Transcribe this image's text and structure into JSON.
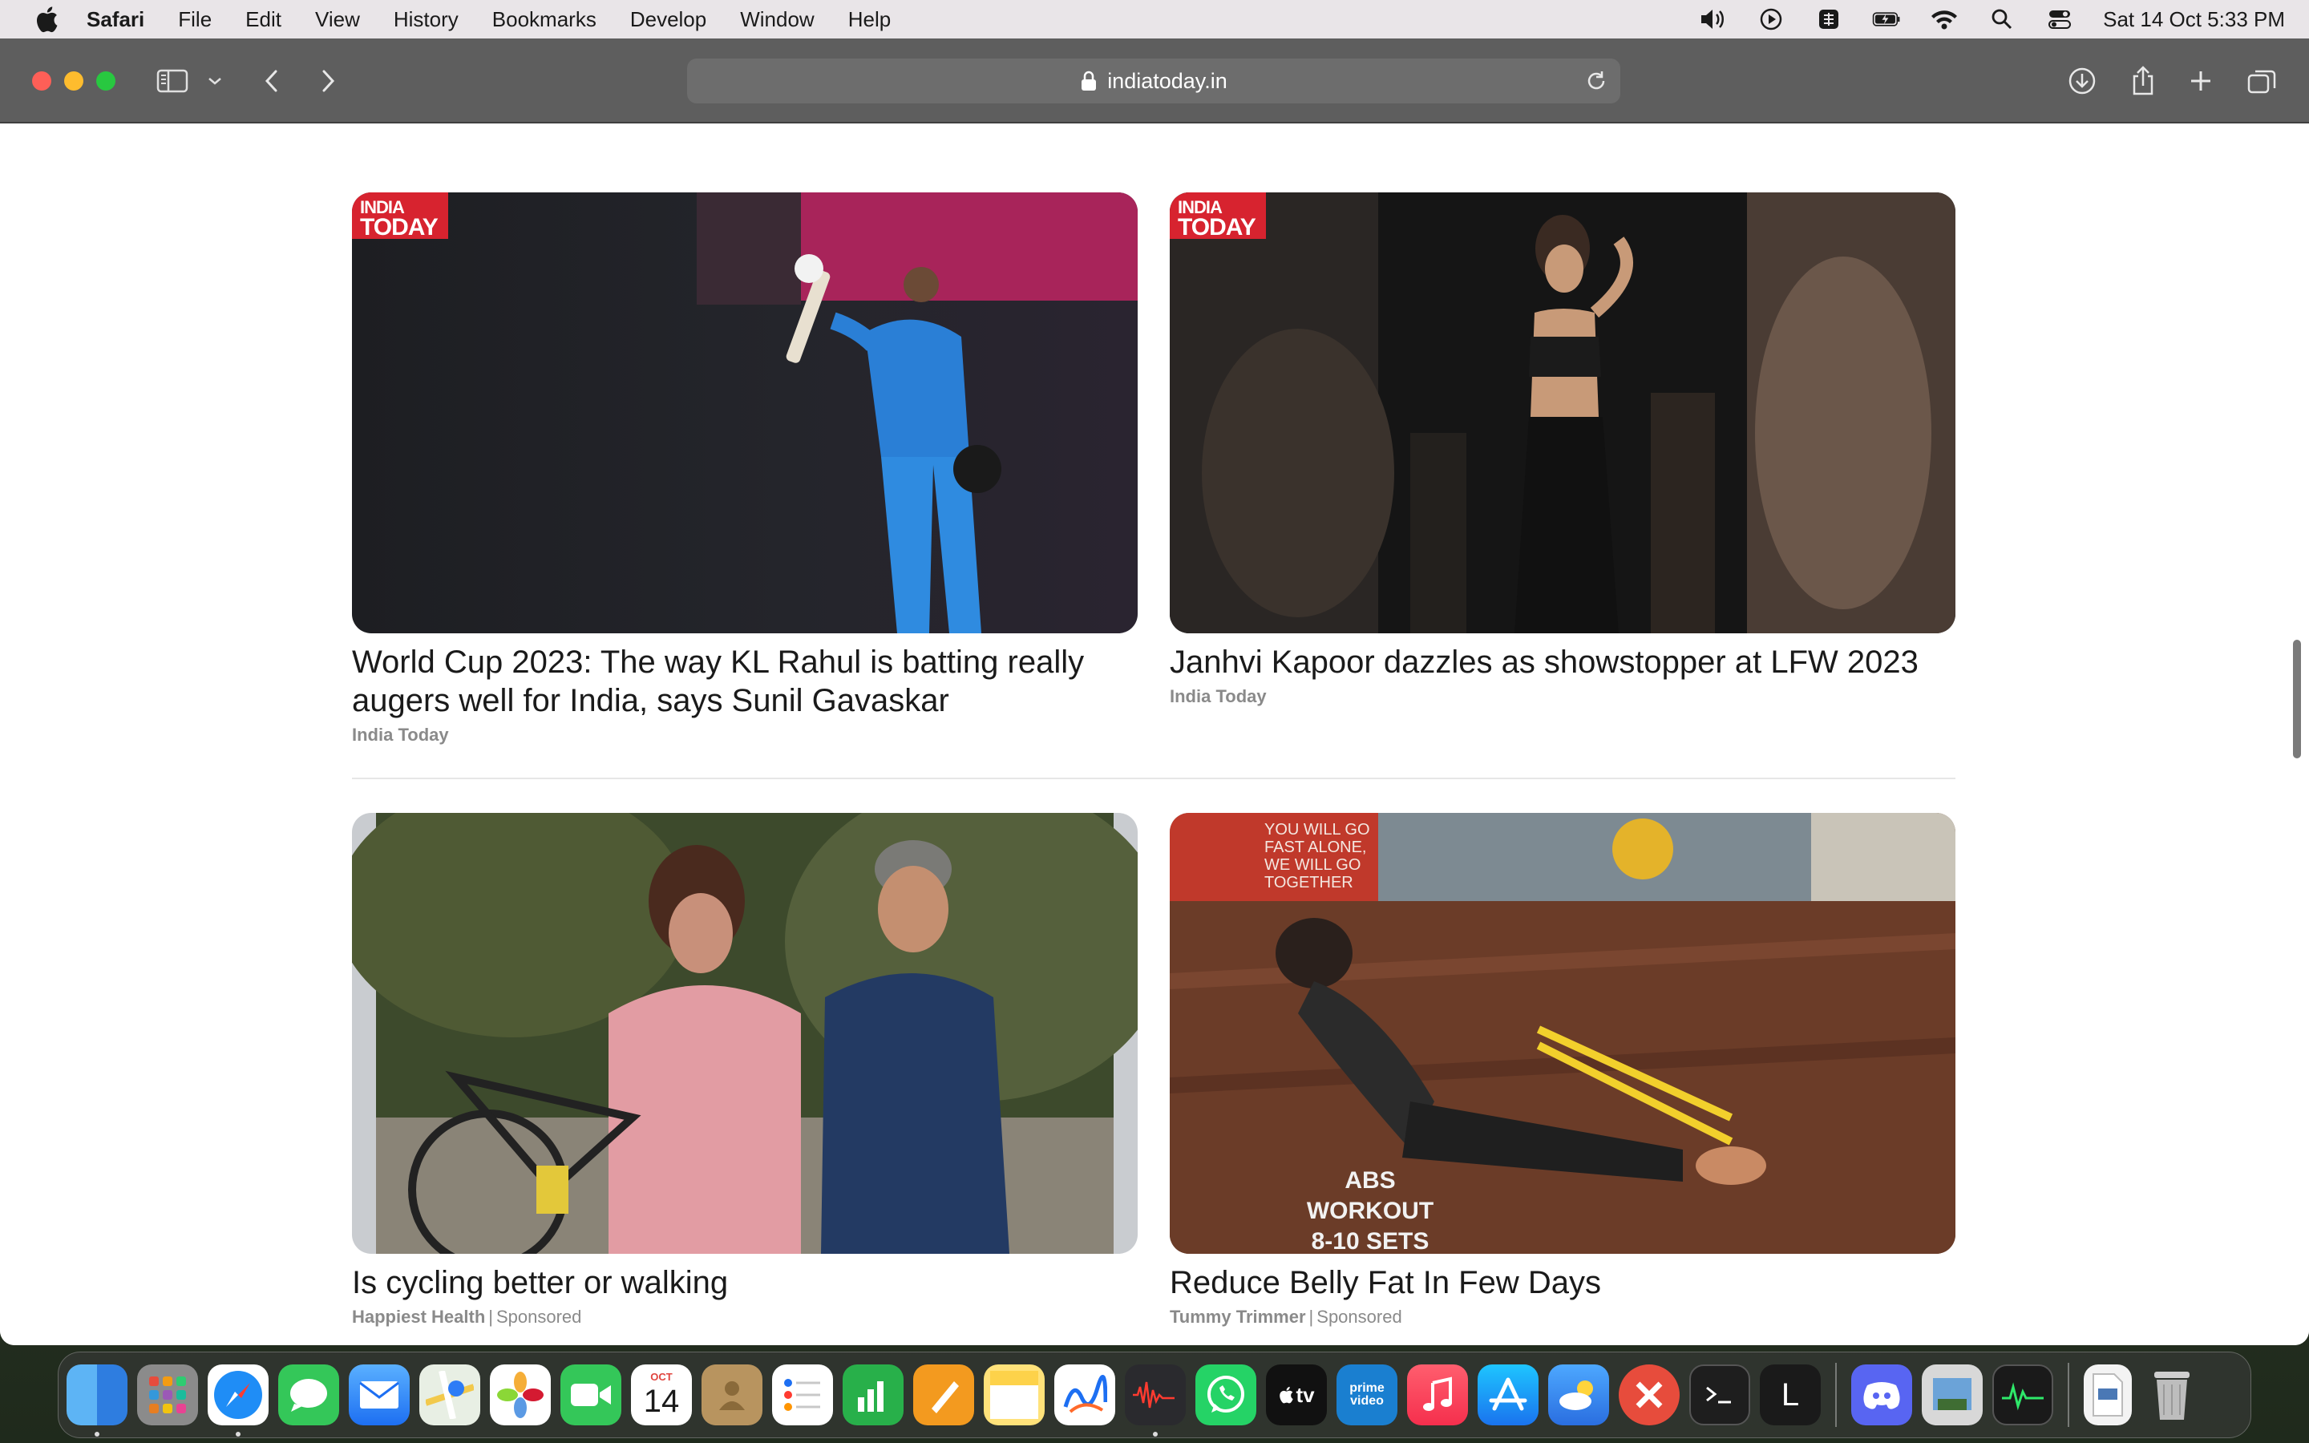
{
  "menubar": {
    "app_name": "Safari",
    "items": [
      "File",
      "Edit",
      "View",
      "History",
      "Bookmarks",
      "Develop",
      "Window",
      "Help"
    ],
    "clock": "Sat 14 Oct  5:33 PM"
  },
  "browser": {
    "url": "indiatoday.in"
  },
  "cards": [
    {
      "title": "World Cup 2023: The way KL Rahul is batting really augers well for India, says Sunil Gavaskar",
      "source": "India Today",
      "badge_line1": "INDIA",
      "badge_line2": "TODAY"
    },
    {
      "title": "Janhvi Kapoor dazzles as showstopper at LFW 2023",
      "source": "India Today",
      "badge_line1": "INDIA",
      "badge_line2": "TODAY"
    },
    {
      "title": "Is cycling better or walking",
      "source": "Happiest Health",
      "sponsored": "Sponsored"
    },
    {
      "title": "Reduce Belly Fat In Few Days",
      "source": "Tummy Trimmer",
      "sponsored": "Sponsored",
      "overlay_line1": "ABS WORKOUT",
      "overlay_line2": "8-10 SETS",
      "wall_text": "YOU WILL GO FAST ALONE, WE WILL GO TOGETHER"
    }
  ],
  "dock": {
    "calendar_month": "OCT",
    "calendar_day": "14",
    "launcher_letter": "L",
    "tv_label": "tv",
    "prime_label": "prime video"
  }
}
